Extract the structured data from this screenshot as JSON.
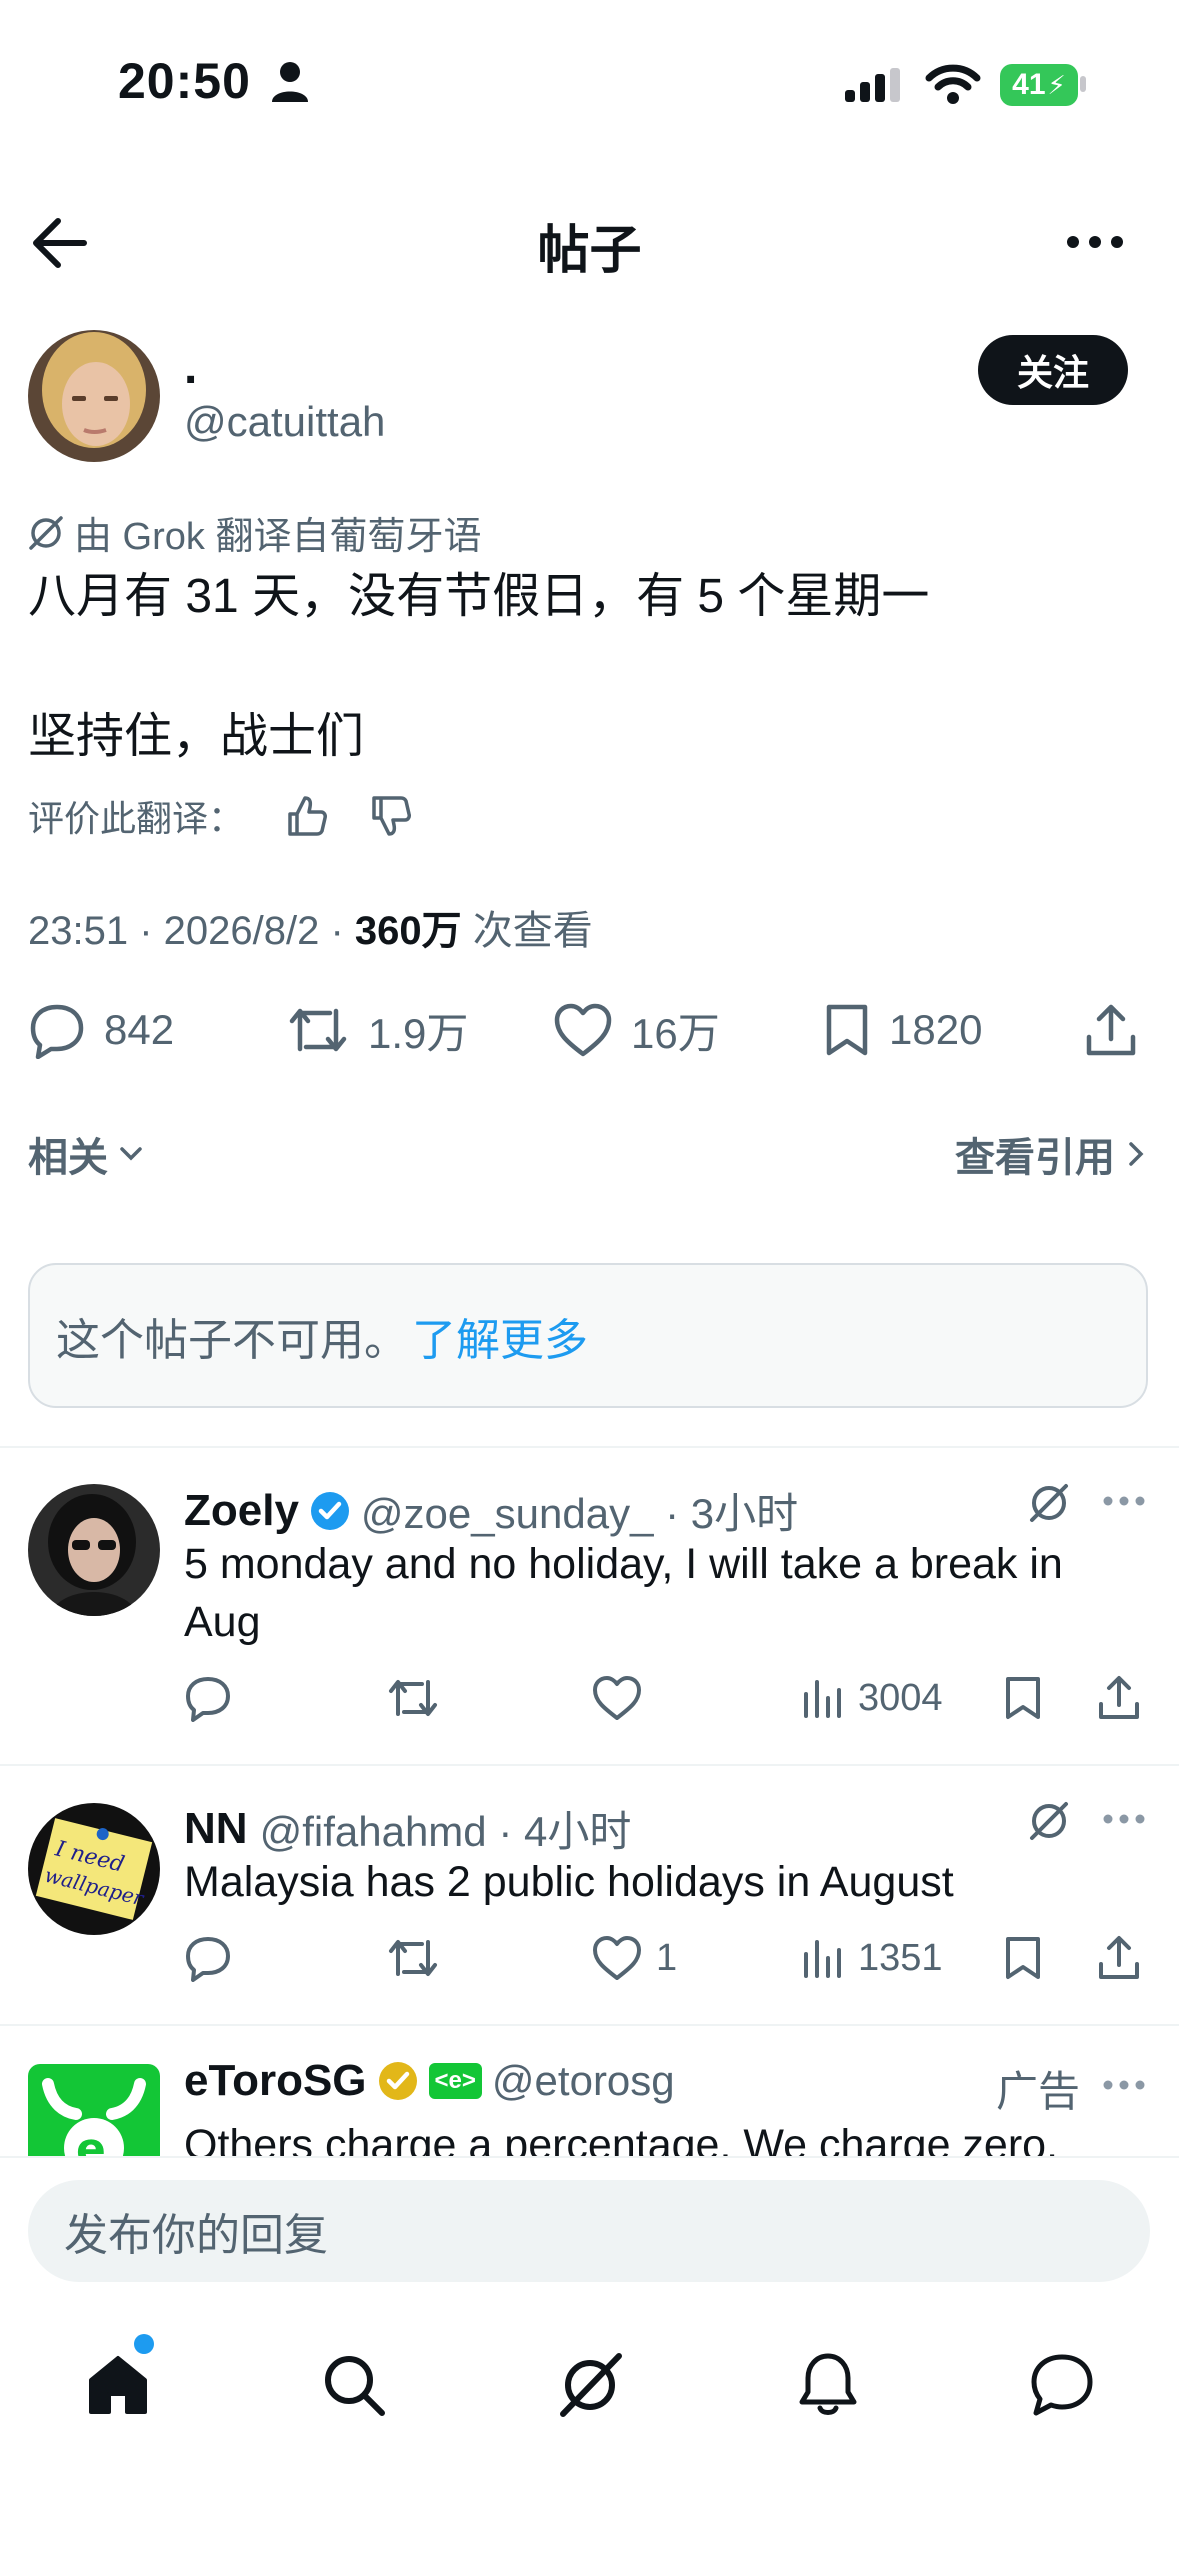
{
  "status_bar": {
    "time": "20:50",
    "battery": "41"
  },
  "nav": {
    "title": "帖子"
  },
  "post": {
    "author_name": ".",
    "author_handle": "@catuittah",
    "follow_label": "关注",
    "translated_note": "由 Grok 翻译自葡萄牙语",
    "text_line1": "八月有 31 天，没有节假日，有 5 个星期一",
    "text_line2": "坚持住，战士们",
    "rate_label": "评价此翻译：",
    "timestamp": "23:51 · 2026/8/2 · ",
    "views_count": "360万",
    "views_label": " 次查看",
    "replies": "842",
    "reposts": "1.9万",
    "likes": "16万",
    "bookmarks": "1820"
  },
  "related": {
    "label": "相关",
    "quotes_label": "查看引用"
  },
  "unavailable": {
    "text": "这个帖子不可用。",
    "link": "了解更多"
  },
  "replies": [
    {
      "name": "Zoely",
      "handle": "@zoe_sunday_ · 3小时",
      "text": "5 monday and no holiday, I will take a break in Aug",
      "likes": "",
      "views": "3004"
    },
    {
      "name": "NN",
      "handle": "@fifahahmd · 4小时",
      "text": "Malaysia has 2 public holidays in August",
      "likes": "1",
      "views": "1351"
    },
    {
      "name": "eToroSG",
      "badge": "<e>",
      "handle": "@etorosg",
      "ad_label": "广告",
      "text": "Others charge a percentage. We charge zero."
    }
  ],
  "reply_bar": {
    "placeholder": "发布你的回复"
  },
  "colors": {
    "accent": "#1d9bf0",
    "text": "#0f1419",
    "muted": "#536471",
    "battery": "#34c759",
    "etoro_green": "#13c636",
    "gold": "#e2b719"
  }
}
